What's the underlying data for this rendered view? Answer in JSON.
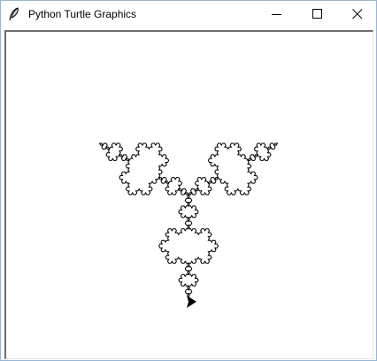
{
  "window": {
    "title": "Python Turtle Graphics",
    "app_icon": "feather-icon",
    "controls": {
      "minimize": "minimize-icon",
      "maximize": "maximize-icon",
      "close": "close-icon"
    }
  },
  "canvas": {
    "background": "#ffffff",
    "drawing": "koch-snowflake",
    "koch_depth": 4,
    "stroke_color": "#000000",
    "turtle_shape": "arrow",
    "turtle_color": "#000000"
  }
}
